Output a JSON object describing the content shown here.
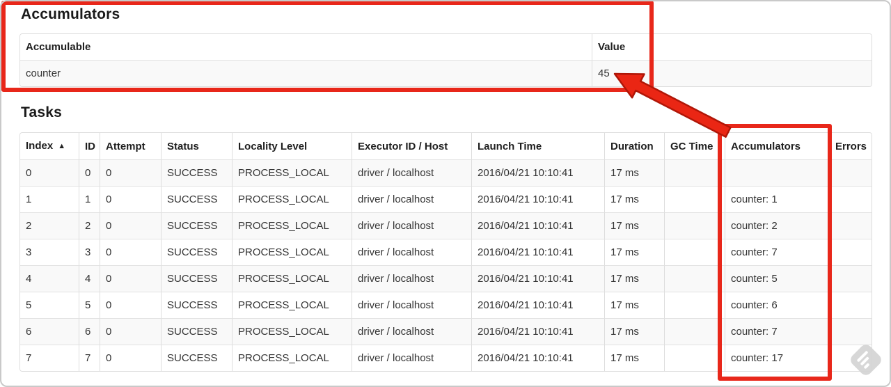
{
  "accumulators_section": {
    "title": "Accumulators",
    "table": {
      "headers": [
        "Accumulable",
        "Value"
      ],
      "headers_interactable": false,
      "rows": [
        [
          "counter",
          "45"
        ]
      ]
    }
  },
  "tasks_section": {
    "title": "Tasks",
    "table": {
      "headers": [
        "Index",
        "ID",
        "Attempt",
        "Status",
        "Locality Level",
        "Executor ID / Host",
        "Launch Time",
        "Duration",
        "GC Time",
        "Accumulators",
        "Errors"
      ],
      "headers_interactable": true,
      "sort_column": 0,
      "sort_icon": "▲",
      "rows": [
        [
          "0",
          "0",
          "0",
          "SUCCESS",
          "PROCESS_LOCAL",
          "driver / localhost",
          "2016/04/21 10:10:41",
          "17 ms",
          "",
          "",
          ""
        ],
        [
          "1",
          "1",
          "0",
          "SUCCESS",
          "PROCESS_LOCAL",
          "driver / localhost",
          "2016/04/21 10:10:41",
          "17 ms",
          "",
          "counter: 1",
          ""
        ],
        [
          "2",
          "2",
          "0",
          "SUCCESS",
          "PROCESS_LOCAL",
          "driver / localhost",
          "2016/04/21 10:10:41",
          "17 ms",
          "",
          "counter: 2",
          ""
        ],
        [
          "3",
          "3",
          "0",
          "SUCCESS",
          "PROCESS_LOCAL",
          "driver / localhost",
          "2016/04/21 10:10:41",
          "17 ms",
          "",
          "counter: 7",
          ""
        ],
        [
          "4",
          "4",
          "0",
          "SUCCESS",
          "PROCESS_LOCAL",
          "driver / localhost",
          "2016/04/21 10:10:41",
          "17 ms",
          "",
          "counter: 5",
          ""
        ],
        [
          "5",
          "5",
          "0",
          "SUCCESS",
          "PROCESS_LOCAL",
          "driver / localhost",
          "2016/04/21 10:10:41",
          "17 ms",
          "",
          "counter: 6",
          ""
        ],
        [
          "6",
          "6",
          "0",
          "SUCCESS",
          "PROCESS_LOCAL",
          "driver / localhost",
          "2016/04/21 10:10:41",
          "17 ms",
          "",
          "counter: 7",
          ""
        ],
        [
          "7",
          "7",
          "0",
          "SUCCESS",
          "PROCESS_LOCAL",
          "driver / localhost",
          "2016/04/21 10:10:41",
          "17 ms",
          "",
          "counter: 17",
          ""
        ]
      ]
    }
  },
  "annotations": {
    "box_color": "#e8271a",
    "arrow_fill": "#ea2614",
    "arrow_stroke": "#b01607"
  },
  "watermark": {
    "diamond_color": "#d5d5d5",
    "stripe_color": "#ffffff"
  }
}
